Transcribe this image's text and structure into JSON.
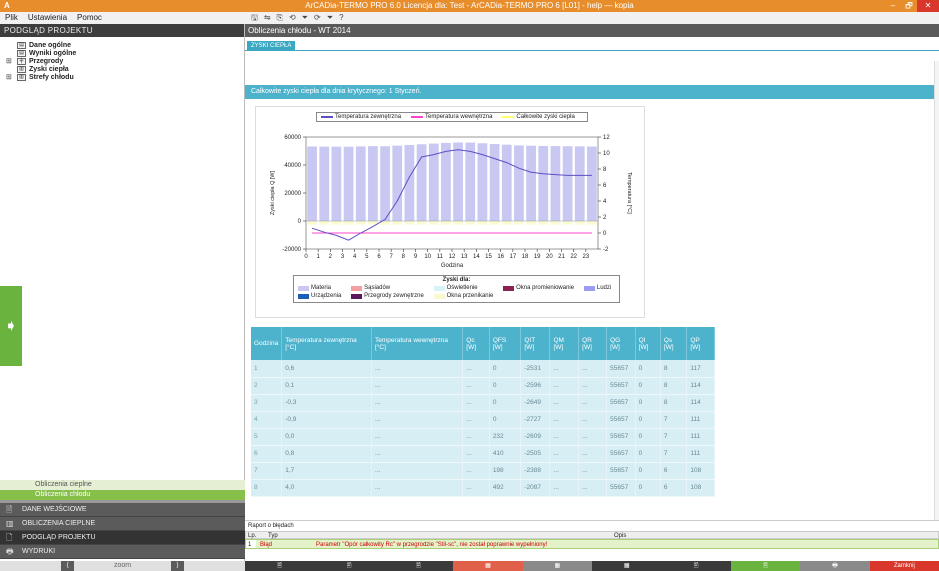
{
  "window": {
    "title": "ArCADia-TERMO PRO 6.0 Licencja dla: Test - ArCADia-TERMO PRO 6 [L01] - help — kopia",
    "minimize": "–",
    "maximize": "🗗",
    "close": "✕"
  },
  "menu": {
    "items": [
      "Plik",
      "Ustawienia",
      "Pomoc"
    ]
  },
  "toolbar": {
    "icons": [
      "🖫",
      "⇋",
      "⎘",
      "⟲",
      "⏷",
      "⟳",
      "⏷",
      "?"
    ]
  },
  "left_panel": {
    "header": "PODGLĄD PROJEKTU",
    "tree": [
      {
        "label": "Dane ogólne",
        "bold": true
      },
      {
        "label": "Wyniki ogólne",
        "bold": true
      },
      {
        "label": "Przegrody",
        "bold": true
      },
      {
        "label": "Zyski ciepła",
        "bold": true
      },
      {
        "label": "Strefy chłodu",
        "bold": true
      }
    ],
    "sub_nav": [
      "Obliczenia cieplne",
      "Obliczenia chłodu"
    ],
    "main_nav": [
      "DANE WEJŚCIOWE",
      "OBLICZENIA CIEPLNE",
      "PODGLĄD PROJEKTU",
      "WYDRUKI"
    ],
    "bottom": {
      "prev": "⟨",
      "label": "zoom",
      "next": "⟩"
    }
  },
  "main": {
    "header": "Obliczenia chłodu - WT 2014",
    "tab": "ZYSKI CIEPŁA",
    "info": "Całkowite zyski ciepła dla dnia krytycznego: 1 Styczeń."
  },
  "chart_data": {
    "type": "bar",
    "x": [
      0,
      1,
      2,
      3,
      4,
      5,
      6,
      7,
      8,
      9,
      10,
      11,
      12,
      13,
      14,
      15,
      16,
      17,
      18,
      19,
      20,
      21,
      22,
      23
    ],
    "xlabel": "Godzina",
    "ylabel": "Zyski ciepła Q [W]",
    "y2label": "Temperatura [°C]",
    "ylim": [
      -20000,
      60000
    ],
    "y2lim": [
      -2,
      12
    ],
    "yticks": [
      "60000",
      "40000",
      "20000",
      "0",
      "-20000"
    ],
    "y2ticks": [
      "12",
      "10",
      "8",
      "6",
      "4",
      "2",
      "0",
      "-2"
    ],
    "series": [
      {
        "name": "Temperatura zewnętrzna",
        "color": "#5b4fc4",
        "values": [
          0.6,
          0.1,
          -0.3,
          -0.9,
          0.0,
          0.8,
          1.7,
          4.0,
          7.0,
          9.5,
          9.8,
          10.2,
          10.4,
          10.2,
          9.8,
          9.3,
          8.8,
          8.1,
          7.6,
          7.4,
          7.3,
          7.2,
          7.2,
          7.2
        ]
      },
      {
        "name": "Temperatura wewnętrzna",
        "color": "#ff44cc",
        "values": [
          0,
          0,
          0,
          0,
          0,
          0,
          0,
          0,
          0,
          0,
          0,
          0,
          0,
          0,
          0,
          0,
          0,
          0,
          0,
          0,
          0,
          0,
          0,
          0
        ]
      },
      {
        "name": "Całkowite zyski ciepła",
        "color": "#ffff66",
        "values": [
          53245,
          53138,
          53121,
          53046,
          53285,
          53486,
          53385,
          53848,
          54300,
          54800,
          55300,
          55800,
          56100,
          56000,
          55500,
          55000,
          54500,
          54000,
          53800,
          53600,
          53500,
          53400,
          53300,
          53200
        ]
      }
    ],
    "legend_title": "Zyski dla:",
    "legend_bottom": [
      {
        "name": "Materia",
        "color": "#c8c8f2"
      },
      {
        "name": "Sąsiadów",
        "color": "#f4a0a0"
      },
      {
        "name": "Oświetlenie",
        "color": "#d8f4f8"
      },
      {
        "name": "Okna promieniowanie",
        "color": "#8b2252"
      },
      {
        "name": "Ludzi",
        "color": "#9b9cf2"
      },
      {
        "name": "Urządzenia",
        "color": "#1a5fb4"
      },
      {
        "name": "Przegrody zewnętrzne",
        "color": "#5c1a5c"
      },
      {
        "name": "Okna przenikanie",
        "color": "#fafad2"
      }
    ]
  },
  "table": {
    "headers": [
      "Godzina",
      "Temperatura zewnętrzna [°C]",
      "Temperatura wewnętrzna [°C]",
      "Qc [W]",
      "QFS [W]",
      "QIT [W]",
      "QM [W]",
      "QR [W]",
      "QG [W]",
      "QI [W]",
      "Qs [W]",
      "QP [W]"
    ],
    "rows": [
      [
        "1",
        "0,6",
        "...",
        "...",
        "0",
        "-2531",
        "...",
        "...",
        "55657",
        "0",
        "8",
        "117"
      ],
      [
        "2",
        "0,1",
        "...",
        "...",
        "0",
        "-2596",
        "...",
        "...",
        "55657",
        "0",
        "8",
        "114"
      ],
      [
        "3",
        "-0,3",
        "...",
        "...",
        "0",
        "-2649",
        "...",
        "...",
        "55657",
        "0",
        "8",
        "114"
      ],
      [
        "4",
        "-0,9",
        "...",
        "...",
        "0",
        "-2727",
        "...",
        "...",
        "55657",
        "0",
        "7",
        "111"
      ],
      [
        "5",
        "0,0",
        "...",
        "...",
        "232",
        "-2609",
        "...",
        "...",
        "55657",
        "0",
        "7",
        "111"
      ],
      [
        "6",
        "0,8",
        "...",
        "...",
        "410",
        "-2505",
        "...",
        "...",
        "55657",
        "0",
        "7",
        "111"
      ],
      [
        "7",
        "1,7",
        "...",
        "...",
        "198",
        "-2388",
        "...",
        "...",
        "55657",
        "0",
        "6",
        "108"
      ],
      [
        "8",
        "4,0",
        "...",
        "...",
        "492",
        "-2087",
        "...",
        "...",
        "55657",
        "0",
        "6",
        "108"
      ]
    ]
  },
  "errors": {
    "title": "Raport o błędach",
    "columns": [
      "Lp.",
      "Typ",
      "Opis"
    ],
    "rows": [
      [
        "1",
        "Błąd",
        "Parametr \"Opór całkowity Rc\" w przegrodzie \"Stil-sc\", nie został poprawnie wypełniony!"
      ]
    ]
  },
  "bottom_bar": {
    "buttons": [
      {
        "label": "🖹",
        "color": "#3a3a3a"
      },
      {
        "label": "🖹",
        "color": "#3a3a3a"
      },
      {
        "label": "🖹",
        "color": "#3a3a3a"
      },
      {
        "label": "▦",
        "color": "#e0604a"
      },
      {
        "label": "▦",
        "color": "#8a8a8a"
      },
      {
        "label": "▦",
        "color": "#3a3a3a"
      },
      {
        "label": "🖹",
        "color": "#3a3a3a"
      },
      {
        "label": "🖹",
        "color": "#6ab33e"
      },
      {
        "label": "🖶",
        "color": "#8a8a8a"
      },
      {
        "label": "Zamknij",
        "color": "#d9362c"
      }
    ]
  }
}
